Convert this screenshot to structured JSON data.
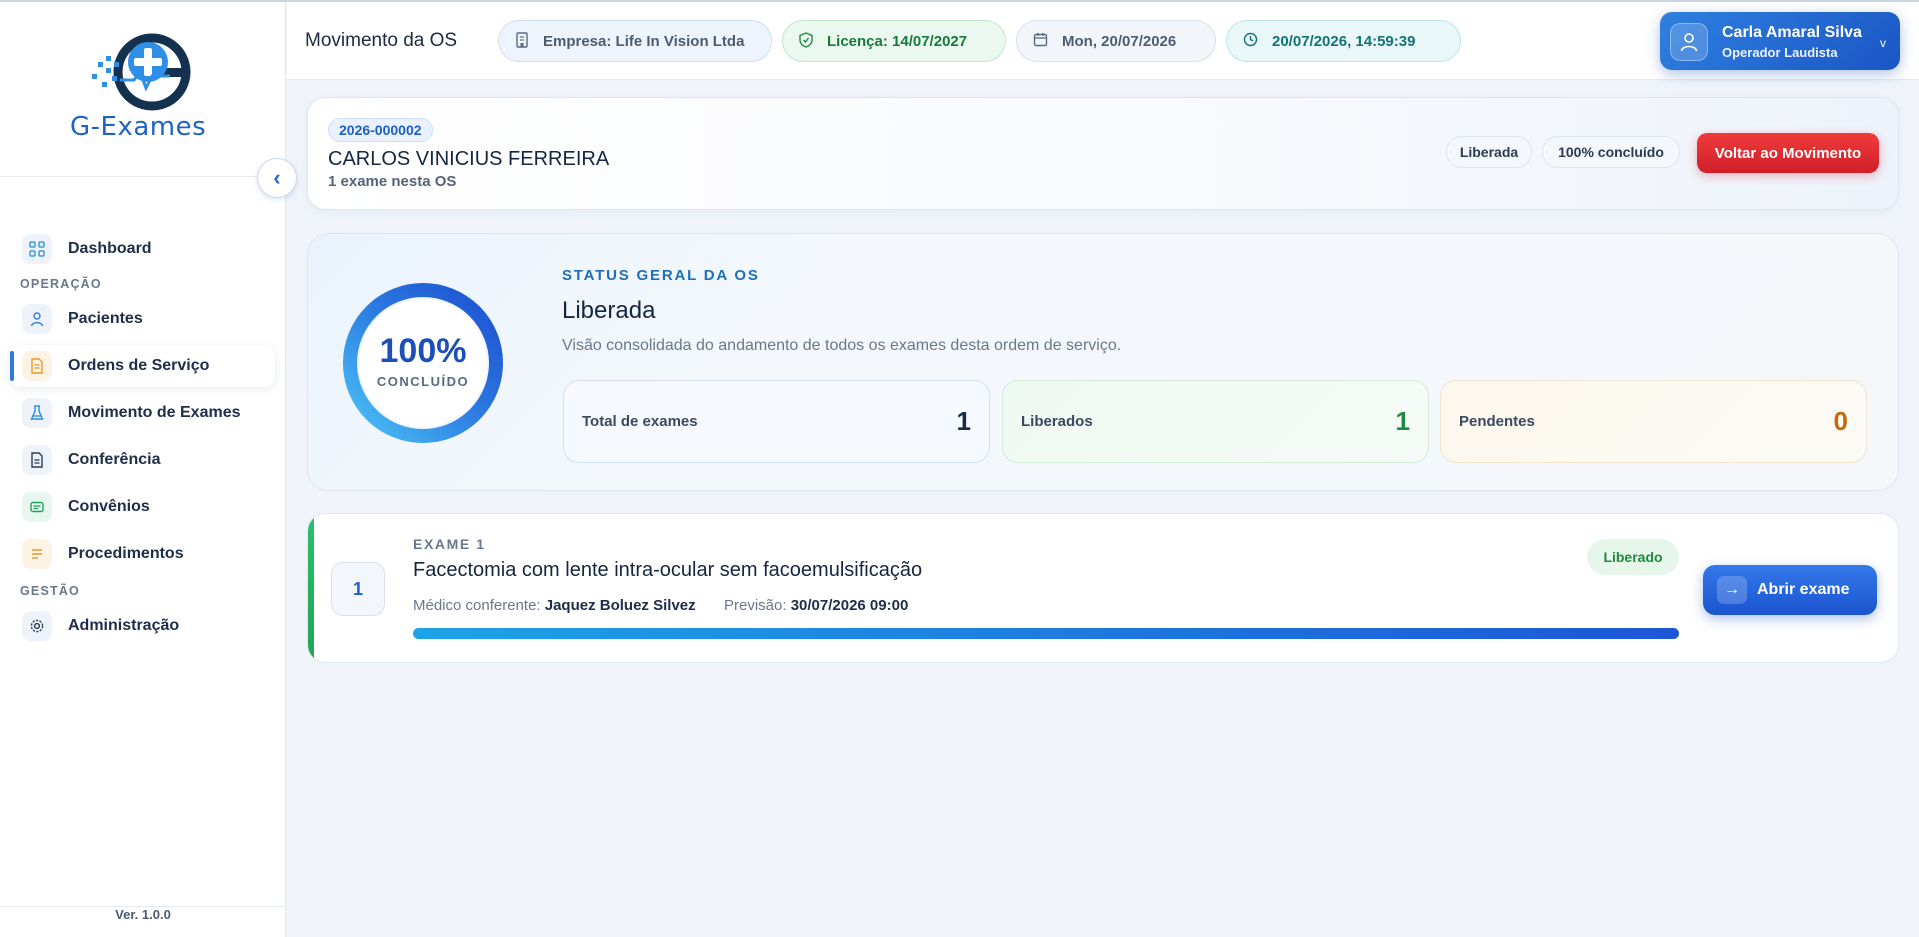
{
  "app": {
    "logo_text": "G-Exames",
    "version": "Ver. 1.0.0"
  },
  "sidebar": {
    "items": [
      {
        "label": "Dashboard",
        "icon": "grid-icon"
      },
      {
        "section": "OPERAÇÃO"
      },
      {
        "label": "Pacientes",
        "icon": "user-icon"
      },
      {
        "label": "Ordens de Serviço",
        "icon": "document-icon"
      },
      {
        "label": "Movimento de Exames",
        "icon": "flask-icon"
      },
      {
        "label": "Conferência",
        "icon": "file-check-icon"
      },
      {
        "label": "Convênios",
        "icon": "card-icon"
      },
      {
        "label": "Procedimentos",
        "icon": "list-icon"
      },
      {
        "section": "GESTÃO"
      },
      {
        "label": "Administração",
        "icon": "gear-icon"
      }
    ],
    "active": "Ordens de Serviço"
  },
  "header": {
    "title": "Movimento da OS",
    "empresa": "Empresa: Life In Vision Ltda",
    "licenca": "Licença: 14/07/2027",
    "date": "Mon, 20/07/2026",
    "datetime": "20/07/2026, 14:59:39",
    "user_name": "Carla Amaral Silva",
    "user_role": "Operador Laudista"
  },
  "os": {
    "number": "2026-000002",
    "patient": "CARLOS VINICIUS FERREIRA",
    "subtitle": "1 exame nesta OS",
    "status_tag": "Liberada",
    "progress_tag": "100% concluído",
    "back_button": "Voltar ao Movimento"
  },
  "status": {
    "percent_text": "100%",
    "percent_value": 100,
    "ring_label": "CONCLUÍDO",
    "eyebrow": "STATUS GERAL DA OS",
    "title": "Liberada",
    "description": "Visão consolidada do andamento de todos os exames desta ordem de serviço.",
    "metrics": {
      "total_label": "Total de exames",
      "total_value": "1",
      "liberados_label": "Liberados",
      "liberados_value": "1",
      "pendentes_label": "Pendentes",
      "pendentes_value": "0"
    }
  },
  "exams": [
    {
      "index": "1",
      "eyebrow": "EXAME 1",
      "title": "Facectomia com lente intra-ocular sem facoemulsificação",
      "medico_label": "Médico conferente:",
      "medico": "Jaquez Boluez Silvez",
      "previsao_label": "Previsão:",
      "previsao": "30/07/2026 09:00",
      "status": "Liberado",
      "progress": 100,
      "open_button": "Abrir exame"
    }
  ],
  "colors": {
    "primary": "#1f63c6",
    "danger": "#d01f28",
    "success": "#1e8a3e",
    "warning": "#c26a0c"
  }
}
